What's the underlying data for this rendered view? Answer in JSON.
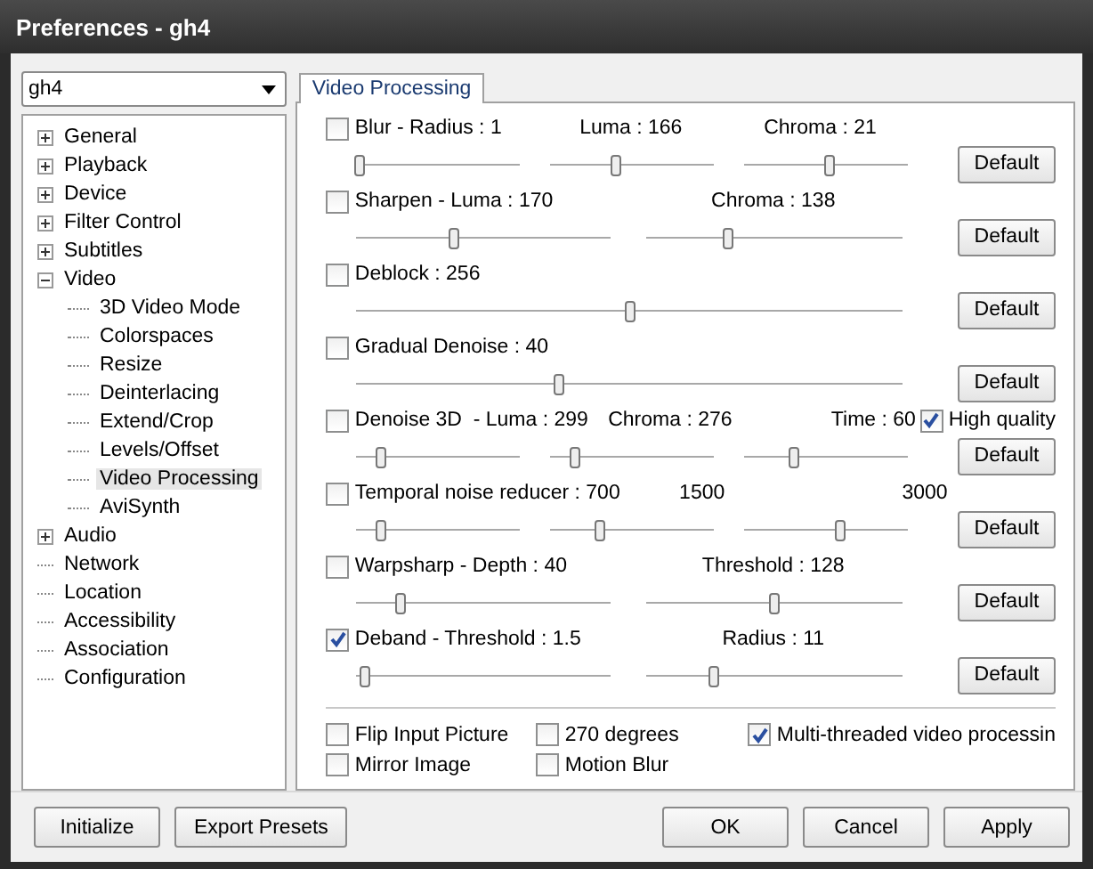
{
  "window": {
    "title": "Preferences - gh4"
  },
  "profile": {
    "value": "gh4"
  },
  "tree": [
    {
      "label": "General",
      "expanded": false,
      "selected": false
    },
    {
      "label": "Playback",
      "expanded": false,
      "selected": false
    },
    {
      "label": "Device",
      "expanded": false,
      "selected": false
    },
    {
      "label": "Filter Control",
      "expanded": false,
      "selected": false
    },
    {
      "label": "Subtitles",
      "expanded": false,
      "selected": false
    },
    {
      "label": "Video",
      "expanded": true,
      "selected": false,
      "children": [
        {
          "label": "3D Video Mode",
          "selected": false
        },
        {
          "label": "Colorspaces",
          "selected": false
        },
        {
          "label": "Resize",
          "selected": false
        },
        {
          "label": "Deinterlacing",
          "selected": false
        },
        {
          "label": "Extend/Crop",
          "selected": false
        },
        {
          "label": "Levels/Offset",
          "selected": false
        },
        {
          "label": "Video Processing",
          "selected": true
        },
        {
          "label": "AviSynth",
          "selected": false
        }
      ]
    },
    {
      "label": "Audio",
      "expanded": false,
      "selected": false
    },
    {
      "label": "Network",
      "selected": false
    },
    {
      "label": "Location",
      "selected": false
    },
    {
      "label": "Accessibility",
      "selected": false
    },
    {
      "label": "Association",
      "selected": false
    },
    {
      "label": "Configuration",
      "selected": false
    }
  ],
  "tab": {
    "label": "Video Processing",
    "selected": true
  },
  "filters": [
    {
      "checked": false,
      "labels": [
        "Blur - Radius : 1",
        "Luma : 166",
        "Chroma : 21"
      ],
      "sliders": [
        {
          "level": 0.02
        },
        {
          "level": 0.4
        },
        {
          "level": 0.52
        }
      ],
      "button": "Default"
    },
    {
      "checked": false,
      "labels": [
        "Sharpen - Luma : 170",
        "Chroma : 138"
      ],
      "sliders": [
        {
          "level": 0.38
        },
        {
          "level": 0.32
        }
      ],
      "button": "Default"
    },
    {
      "checked": false,
      "labels": [
        "Deblock : 256"
      ],
      "sliders": [
        {
          "level": 0.5
        }
      ],
      "button": "Default"
    },
    {
      "checked": false,
      "labels": [
        "Gradual Denoise : 40"
      ],
      "sliders": [
        {
          "level": 0.37
        }
      ],
      "button": "Default"
    },
    {
      "checked": false,
      "labels": [
        "Denoise 3D  - Luma : 299",
        "Chroma : 276",
        "Time : 60"
      ],
      "extra": {
        "label": "High quality",
        "checked": true
      },
      "sliders": [
        {
          "level": 0.15
        },
        {
          "level": 0.15
        },
        {
          "level": 0.3
        }
      ],
      "button": "Default"
    },
    {
      "checked": false,
      "labels": [
        "Temporal noise reducer : 700",
        "1500",
        "3000"
      ],
      "sliders": [
        {
          "level": 0.15
        },
        {
          "level": 0.3
        },
        {
          "level": 0.58
        }
      ],
      "button": "Default"
    },
    {
      "checked": false,
      "labels": [
        "Warpsharp - Depth : 40",
        "Threshold : 128"
      ],
      "sliders": [
        {
          "level": 0.17
        },
        {
          "level": 0.5
        }
      ],
      "button": "Default"
    },
    {
      "checked": true,
      "labels": [
        "Deband - Threshold : 1.5",
        "Radius : 11"
      ],
      "sliders": [
        {
          "level": 0.03
        },
        {
          "level": 0.26
        }
      ],
      "button": "Default"
    }
  ],
  "options": [
    {
      "label": "Flip Input Picture",
      "checked": false
    },
    {
      "label": "270 degrees",
      "checked": false
    },
    {
      "label": "Multi-threaded video processin",
      "checked": true
    },
    {
      "label": "Mirror Image",
      "checked": false
    },
    {
      "label": "Motion Blur",
      "checked": false
    }
  ],
  "footer": {
    "left": [
      "Initialize",
      "Export Presets"
    ],
    "right": [
      "OK",
      "Cancel",
      "Apply"
    ]
  }
}
